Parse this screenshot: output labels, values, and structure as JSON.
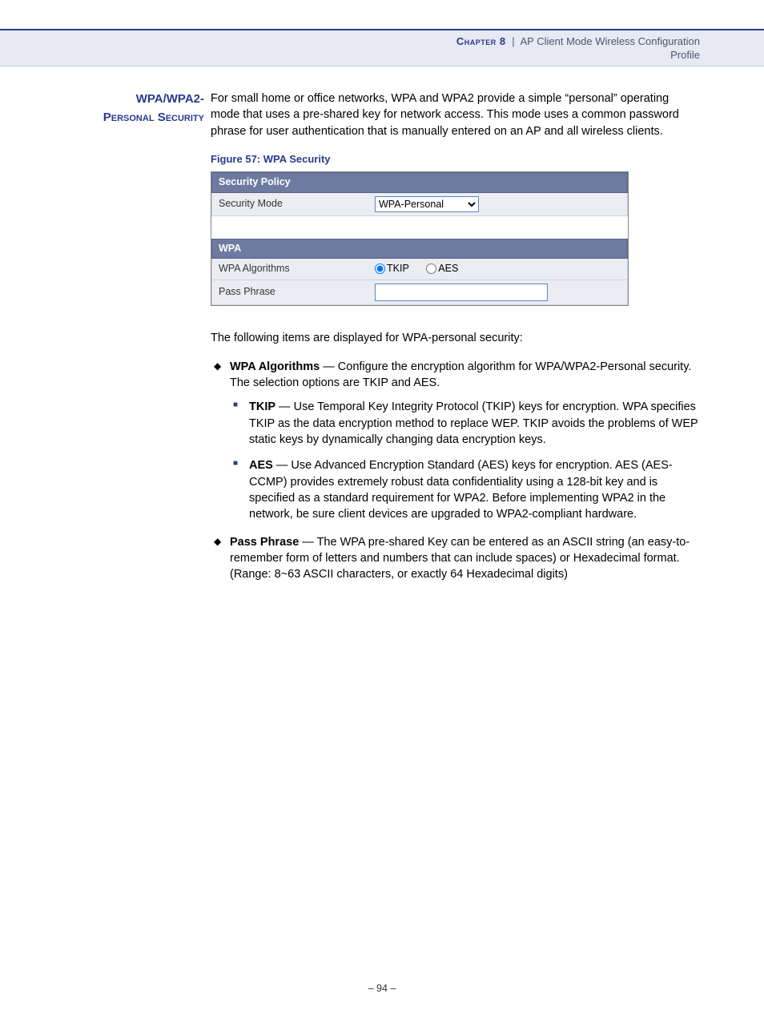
{
  "header": {
    "chapter": "Chapter 8",
    "separator": "|",
    "title": "AP Client Mode Wireless Configuration",
    "subtitle": "Profile"
  },
  "side_heading": {
    "line1": "WPA/WPA2-",
    "line2": "Personal Security"
  },
  "intro_paragraph": "For small home or office networks, WPA and WPA2 provide a simple “personal” operating mode that uses a pre-shared key for network access. This mode uses a common password phrase for user authentication that is manually entered on an AP and all wireless clients.",
  "figure_caption": "Figure 57:  WPA Security",
  "figure": {
    "section1_title": "Security Policy",
    "security_mode_label": "Security Mode",
    "security_mode_value": "WPA-Personal",
    "section2_title": "WPA",
    "algorithms_label": "WPA Algorithms",
    "radio_tkip": "TKIP",
    "radio_aes": "AES",
    "passphrase_label": "Pass Phrase",
    "passphrase_value": ""
  },
  "intro_items": "The following items are displayed for WPA-personal security:",
  "items": {
    "algorithms": {
      "term": "WPA Algorithms",
      "dash": " — ",
      "desc": "Configure the encryption algorithm for WPA/WPA2-Personal security. The selection options are TKIP and AES.",
      "tkip": {
        "term": "TKIP",
        "dash": " — ",
        "desc": "Use Temporal Key Integrity Protocol (TKIP) keys for encryption. WPA specifies TKIP as the data encryption method to replace WEP. TKIP avoids the problems of WEP static keys by dynamically changing data encryption keys."
      },
      "aes": {
        "term": "AES",
        "dash": " — ",
        "desc": "Use Advanced Encryption Standard (AES) keys for encryption. AES (AES-CCMP) provides extremely robust data confidentiality using a 128-bit key and is specified as a standard requirement for WPA2. Before implementing WPA2 in the network, be sure client devices are upgraded to WPA2-compliant hardware."
      }
    },
    "passphrase": {
      "term": "Pass Phrase",
      "dash": " — ",
      "desc": "The WPA pre-shared Key can be entered as an ASCII string (an easy-to-remember form of letters and numbers that can include spaces) or Hexadecimal format. (Range: 8~63 ASCII characters, or exactly 64 Hexadecimal digits)"
    }
  },
  "footer": "–  94  –"
}
